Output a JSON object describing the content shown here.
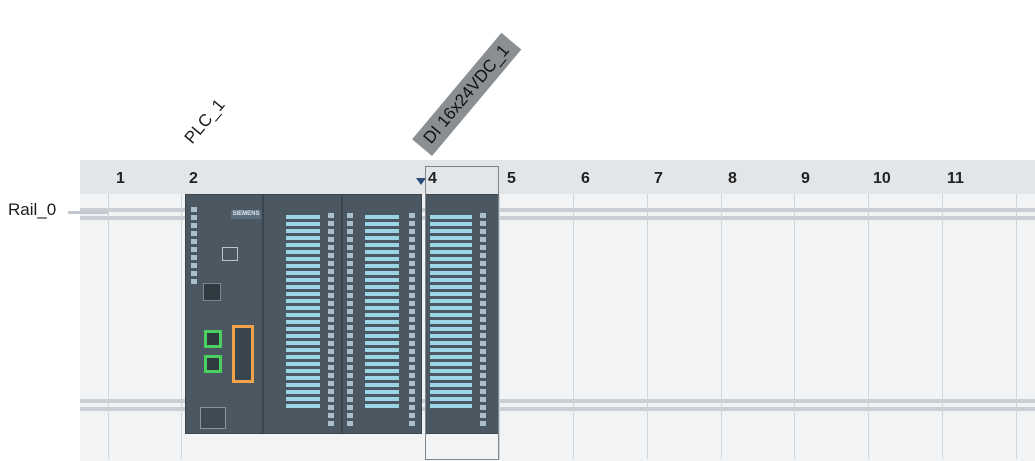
{
  "device_labels": {
    "plc": "PLC_1",
    "di_module": "DI 16x24VDC_1"
  },
  "rail": {
    "label": "Rail_0"
  },
  "slots": [
    "1",
    "2",
    "4",
    "5",
    "6",
    "7",
    "8",
    "9",
    "10",
    "11"
  ],
  "cpu": {
    "brand": "SIEMENS"
  },
  "colors": {
    "module_body": "#4b5862",
    "header": "#e3e6e9",
    "rail_background": "#f1f3f5",
    "selection_label": "#8a8f94",
    "profinet_port": "#49d05d",
    "dp_port": "#f0a34b",
    "io_bars": "#9ad6e6"
  },
  "icons": {
    "drop_marker": "triangle-down-icon",
    "ethernet_ports": "ethernet-port-icon",
    "profibus_port": "sub-d-connector-icon"
  }
}
